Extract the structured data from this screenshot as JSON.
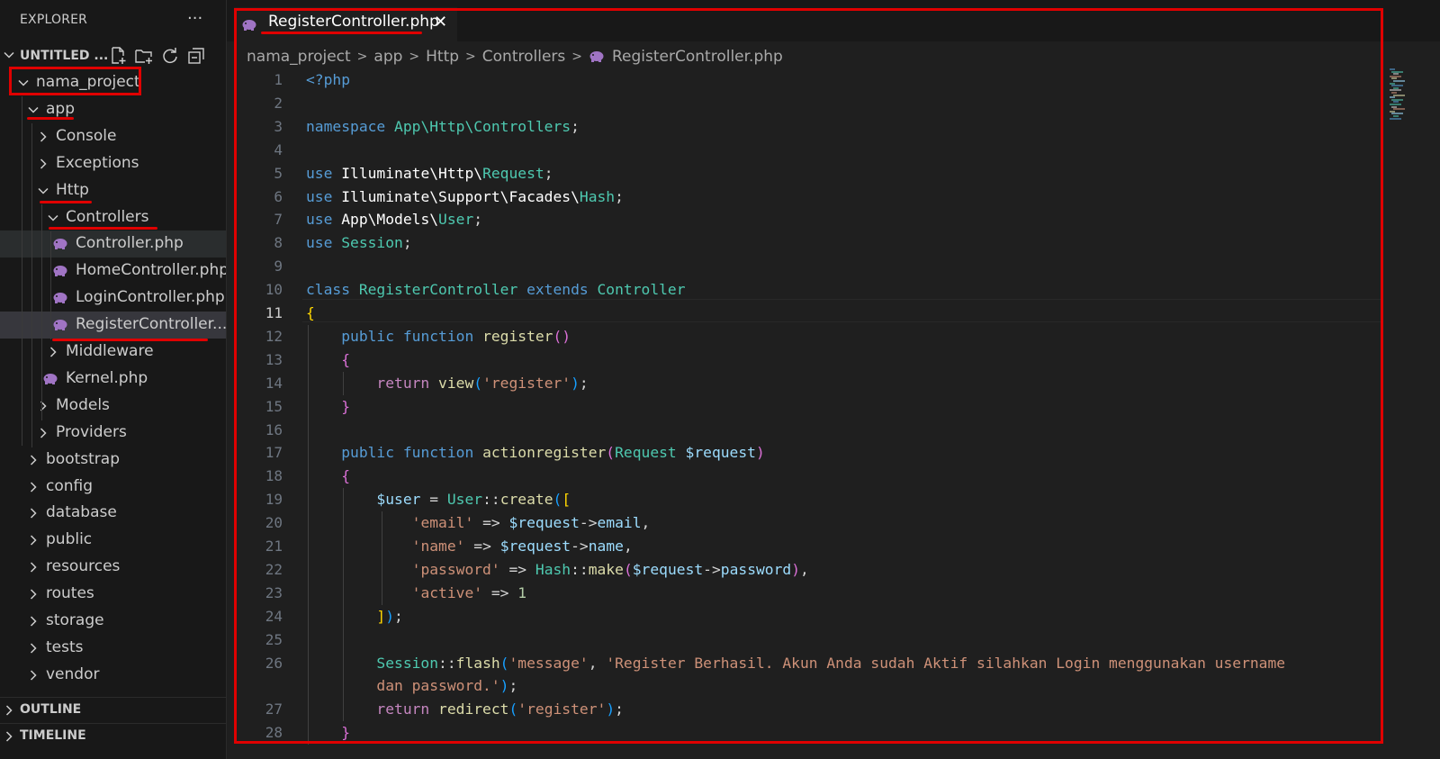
{
  "colors": {
    "annotation_red": "#e00000",
    "php_icon": "#a074c4",
    "sidebar_bg": "#181818",
    "editor_bg": "#1f1f1f"
  },
  "sidebar": {
    "header_title": "EXPLORER",
    "more_icon": "more-icon",
    "workspace_title": "UNTITLED ...",
    "workspace_actions": [
      "new-file-icon",
      "new-folder-icon",
      "refresh-icon",
      "collapse-all-icon"
    ],
    "tree": [
      {
        "label": "nama_project",
        "depth": 0,
        "expanded": true
      },
      {
        "label": "app",
        "depth": 1,
        "expanded": true
      },
      {
        "label": "Console",
        "depth": 2,
        "expanded": false
      },
      {
        "label": "Exceptions",
        "depth": 2,
        "expanded": false
      },
      {
        "label": "Http",
        "depth": 2,
        "expanded": true
      },
      {
        "label": "Controllers",
        "depth": 3,
        "expanded": true
      },
      {
        "label": "Controller.php",
        "depth": 4,
        "file": true
      },
      {
        "label": "HomeController.php",
        "depth": 4,
        "file": true
      },
      {
        "label": "LoginController.php",
        "depth": 4,
        "file": true
      },
      {
        "label": "RegisterController....",
        "depth": 4,
        "file": true,
        "selected": true
      },
      {
        "label": "Middleware",
        "depth": 3,
        "expanded": false
      },
      {
        "label": "Kernel.php",
        "depth": 3,
        "file": true
      },
      {
        "label": "Models",
        "depth": 2,
        "expanded": false
      },
      {
        "label": "Providers",
        "depth": 2,
        "expanded": false
      },
      {
        "label": "bootstrap",
        "depth": 1,
        "expanded": false
      },
      {
        "label": "config",
        "depth": 1,
        "expanded": false
      },
      {
        "label": "database",
        "depth": 1,
        "expanded": false
      },
      {
        "label": "public",
        "depth": 1,
        "expanded": false
      },
      {
        "label": "resources",
        "depth": 1,
        "expanded": false
      },
      {
        "label": "routes",
        "depth": 1,
        "expanded": false
      },
      {
        "label": "storage",
        "depth": 1,
        "expanded": false
      },
      {
        "label": "tests",
        "depth": 1,
        "expanded": false
      },
      {
        "label": "vendor",
        "depth": 1,
        "expanded": false
      }
    ],
    "sections": [
      {
        "label": "OUTLINE"
      },
      {
        "label": "TIMELINE"
      }
    ]
  },
  "editor": {
    "tab": {
      "label": "RegisterController.php",
      "close_glyph": "✕"
    },
    "breadcrumb": [
      "nama_project",
      "app",
      "Http",
      "Controllers",
      "RegisterController.php"
    ],
    "current_line": 11,
    "line_numbers": [
      "1",
      "2",
      "3",
      "4",
      "5",
      "6",
      "7",
      "8",
      "9",
      "10",
      "11",
      "12",
      "13",
      "14",
      "15",
      "16",
      "17",
      "18",
      "19",
      "20",
      "21",
      "22",
      "23",
      "24",
      "25",
      "26",
      "",
      "27",
      "28"
    ],
    "lines": [
      [
        [
          "kw",
          "<?php"
        ]
      ],
      [],
      [
        [
          "kw",
          "namespace "
        ],
        [
          "ty",
          "App\\Http\\Controllers"
        ],
        [
          "tx",
          ";"
        ]
      ],
      [],
      [
        [
          "kw",
          "use "
        ],
        [
          "wh",
          "Illuminate\\Http\\"
        ],
        [
          "ty",
          "Request"
        ],
        [
          "tx",
          ";"
        ]
      ],
      [
        [
          "kw",
          "use "
        ],
        [
          "wh",
          "Illuminate\\Support\\Facades\\"
        ],
        [
          "ty",
          "Hash"
        ],
        [
          "tx",
          ";"
        ]
      ],
      [
        [
          "kw",
          "use "
        ],
        [
          "wh",
          "App\\Models\\"
        ],
        [
          "ty",
          "User"
        ],
        [
          "tx",
          ";"
        ]
      ],
      [
        [
          "kw",
          "use "
        ],
        [
          "ty",
          "Session"
        ],
        [
          "tx",
          ";"
        ]
      ],
      [],
      [
        [
          "kw",
          "class "
        ],
        [
          "ty",
          "RegisterController "
        ],
        [
          "kw",
          "extends "
        ],
        [
          "ty",
          "Controller"
        ]
      ],
      [
        [
          "b1",
          "{"
        ]
      ],
      [
        [
          "tx",
          "    "
        ],
        [
          "kw",
          "public function "
        ],
        [
          "fn",
          "register"
        ],
        [
          "b2",
          "()"
        ]
      ],
      [
        [
          "tx",
          "    "
        ],
        [
          "b2",
          "{"
        ]
      ],
      [
        [
          "tx",
          "        "
        ],
        [
          "cf",
          "return "
        ],
        [
          "fn",
          "view"
        ],
        [
          "b3",
          "("
        ],
        [
          "st",
          "'register'"
        ],
        [
          "b3",
          ")"
        ],
        [
          "tx",
          ";"
        ]
      ],
      [
        [
          "tx",
          "    "
        ],
        [
          "b2",
          "}"
        ]
      ],
      [],
      [
        [
          "tx",
          "    "
        ],
        [
          "kw",
          "public function "
        ],
        [
          "fn",
          "actionregister"
        ],
        [
          "b2",
          "("
        ],
        [
          "ty",
          "Request "
        ],
        [
          "vr",
          "$request"
        ],
        [
          "b2",
          ")"
        ]
      ],
      [
        [
          "tx",
          "    "
        ],
        [
          "b2",
          "{"
        ]
      ],
      [
        [
          "tx",
          "        "
        ],
        [
          "vr",
          "$user"
        ],
        [
          "tx",
          " = "
        ],
        [
          "ty",
          "User"
        ],
        [
          "tx",
          "::"
        ],
        [
          "fn",
          "create"
        ],
        [
          "b3",
          "("
        ],
        [
          "b1",
          "["
        ]
      ],
      [
        [
          "tx",
          "            "
        ],
        [
          "st",
          "'email'"
        ],
        [
          "tx",
          " => "
        ],
        [
          "vr",
          "$request"
        ],
        [
          "tx",
          "->"
        ],
        [
          "vr",
          "email"
        ],
        [
          "tx",
          ","
        ]
      ],
      [
        [
          "tx",
          "            "
        ],
        [
          "st",
          "'name'"
        ],
        [
          "tx",
          " => "
        ],
        [
          "vr",
          "$request"
        ],
        [
          "tx",
          "->"
        ],
        [
          "vr",
          "name"
        ],
        [
          "tx",
          ","
        ]
      ],
      [
        [
          "tx",
          "            "
        ],
        [
          "st",
          "'password'"
        ],
        [
          "tx",
          " => "
        ],
        [
          "ty",
          "Hash"
        ],
        [
          "tx",
          "::"
        ],
        [
          "fn",
          "make"
        ],
        [
          "b2",
          "("
        ],
        [
          "vr",
          "$request"
        ],
        [
          "tx",
          "->"
        ],
        [
          "vr",
          "password"
        ],
        [
          "b2",
          ")"
        ],
        [
          "tx",
          ","
        ]
      ],
      [
        [
          "tx",
          "            "
        ],
        [
          "st",
          "'active'"
        ],
        [
          "tx",
          " => "
        ],
        [
          "nm",
          "1"
        ]
      ],
      [
        [
          "tx",
          "        "
        ],
        [
          "b1",
          "]"
        ],
        [
          "b3",
          ")"
        ],
        [
          "tx",
          ";"
        ]
      ],
      [],
      [
        [
          "tx",
          "        "
        ],
        [
          "ty",
          "Session"
        ],
        [
          "tx",
          "::"
        ],
        [
          "fn",
          "flash"
        ],
        [
          "b3",
          "("
        ],
        [
          "st",
          "'message'"
        ],
        [
          "tx",
          ", "
        ],
        [
          "st",
          "'Register Berhasil. Akun Anda sudah Aktif silahkan Login menggunakan username"
        ]
      ],
      [
        [
          "st",
          "        dan password.'"
        ],
        [
          "b3",
          ")"
        ],
        [
          "tx",
          ";"
        ]
      ],
      [
        [
          "tx",
          "        "
        ],
        [
          "cf",
          "return "
        ],
        [
          "fn",
          "redirect"
        ],
        [
          "b3",
          "("
        ],
        [
          "st",
          "'register'"
        ],
        [
          "b3",
          ")"
        ],
        [
          "tx",
          ";"
        ]
      ],
      [
        [
          "tx",
          "    "
        ],
        [
          "b2",
          "}"
        ]
      ]
    ]
  }
}
